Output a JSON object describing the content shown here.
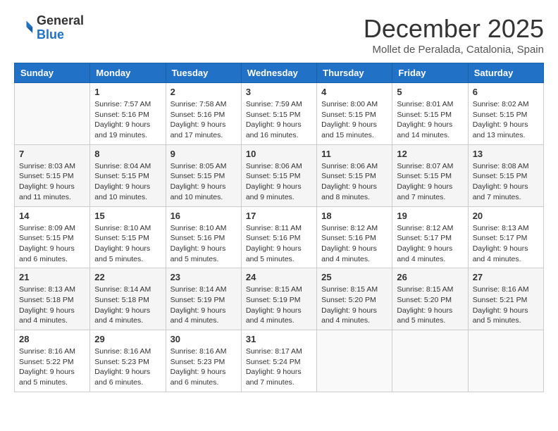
{
  "logo": {
    "general": "General",
    "blue": "Blue"
  },
  "header": {
    "month": "December 2025",
    "location": "Mollet de Peralada, Catalonia, Spain"
  },
  "weekdays": [
    "Sunday",
    "Monday",
    "Tuesday",
    "Wednesday",
    "Thursday",
    "Friday",
    "Saturday"
  ],
  "weeks": [
    [
      {
        "day": "",
        "info": ""
      },
      {
        "day": "1",
        "info": "Sunrise: 7:57 AM\nSunset: 5:16 PM\nDaylight: 9 hours\nand 19 minutes."
      },
      {
        "day": "2",
        "info": "Sunrise: 7:58 AM\nSunset: 5:16 PM\nDaylight: 9 hours\nand 17 minutes."
      },
      {
        "day": "3",
        "info": "Sunrise: 7:59 AM\nSunset: 5:15 PM\nDaylight: 9 hours\nand 16 minutes."
      },
      {
        "day": "4",
        "info": "Sunrise: 8:00 AM\nSunset: 5:15 PM\nDaylight: 9 hours\nand 15 minutes."
      },
      {
        "day": "5",
        "info": "Sunrise: 8:01 AM\nSunset: 5:15 PM\nDaylight: 9 hours\nand 14 minutes."
      },
      {
        "day": "6",
        "info": "Sunrise: 8:02 AM\nSunset: 5:15 PM\nDaylight: 9 hours\nand 13 minutes."
      }
    ],
    [
      {
        "day": "7",
        "info": "Sunrise: 8:03 AM\nSunset: 5:15 PM\nDaylight: 9 hours\nand 11 minutes."
      },
      {
        "day": "8",
        "info": "Sunrise: 8:04 AM\nSunset: 5:15 PM\nDaylight: 9 hours\nand 10 minutes."
      },
      {
        "day": "9",
        "info": "Sunrise: 8:05 AM\nSunset: 5:15 PM\nDaylight: 9 hours\nand 10 minutes."
      },
      {
        "day": "10",
        "info": "Sunrise: 8:06 AM\nSunset: 5:15 PM\nDaylight: 9 hours\nand 9 minutes."
      },
      {
        "day": "11",
        "info": "Sunrise: 8:06 AM\nSunset: 5:15 PM\nDaylight: 9 hours\nand 8 minutes."
      },
      {
        "day": "12",
        "info": "Sunrise: 8:07 AM\nSunset: 5:15 PM\nDaylight: 9 hours\nand 7 minutes."
      },
      {
        "day": "13",
        "info": "Sunrise: 8:08 AM\nSunset: 5:15 PM\nDaylight: 9 hours\nand 7 minutes."
      }
    ],
    [
      {
        "day": "14",
        "info": "Sunrise: 8:09 AM\nSunset: 5:15 PM\nDaylight: 9 hours\nand 6 minutes."
      },
      {
        "day": "15",
        "info": "Sunrise: 8:10 AM\nSunset: 5:15 PM\nDaylight: 9 hours\nand 5 minutes."
      },
      {
        "day": "16",
        "info": "Sunrise: 8:10 AM\nSunset: 5:16 PM\nDaylight: 9 hours\nand 5 minutes."
      },
      {
        "day": "17",
        "info": "Sunrise: 8:11 AM\nSunset: 5:16 PM\nDaylight: 9 hours\nand 5 minutes."
      },
      {
        "day": "18",
        "info": "Sunrise: 8:12 AM\nSunset: 5:16 PM\nDaylight: 9 hours\nand 4 minutes."
      },
      {
        "day": "19",
        "info": "Sunrise: 8:12 AM\nSunset: 5:17 PM\nDaylight: 9 hours\nand 4 minutes."
      },
      {
        "day": "20",
        "info": "Sunrise: 8:13 AM\nSunset: 5:17 PM\nDaylight: 9 hours\nand 4 minutes."
      }
    ],
    [
      {
        "day": "21",
        "info": "Sunrise: 8:13 AM\nSunset: 5:18 PM\nDaylight: 9 hours\nand 4 minutes."
      },
      {
        "day": "22",
        "info": "Sunrise: 8:14 AM\nSunset: 5:18 PM\nDaylight: 9 hours\nand 4 minutes."
      },
      {
        "day": "23",
        "info": "Sunrise: 8:14 AM\nSunset: 5:19 PM\nDaylight: 9 hours\nand 4 minutes."
      },
      {
        "day": "24",
        "info": "Sunrise: 8:15 AM\nSunset: 5:19 PM\nDaylight: 9 hours\nand 4 minutes."
      },
      {
        "day": "25",
        "info": "Sunrise: 8:15 AM\nSunset: 5:20 PM\nDaylight: 9 hours\nand 4 minutes."
      },
      {
        "day": "26",
        "info": "Sunrise: 8:15 AM\nSunset: 5:20 PM\nDaylight: 9 hours\nand 5 minutes."
      },
      {
        "day": "27",
        "info": "Sunrise: 8:16 AM\nSunset: 5:21 PM\nDaylight: 9 hours\nand 5 minutes."
      }
    ],
    [
      {
        "day": "28",
        "info": "Sunrise: 8:16 AM\nSunset: 5:22 PM\nDaylight: 9 hours\nand 5 minutes."
      },
      {
        "day": "29",
        "info": "Sunrise: 8:16 AM\nSunset: 5:23 PM\nDaylight: 9 hours\nand 6 minutes."
      },
      {
        "day": "30",
        "info": "Sunrise: 8:16 AM\nSunset: 5:23 PM\nDaylight: 9 hours\nand 6 minutes."
      },
      {
        "day": "31",
        "info": "Sunrise: 8:17 AM\nSunset: 5:24 PM\nDaylight: 9 hours\nand 7 minutes."
      },
      {
        "day": "",
        "info": ""
      },
      {
        "day": "",
        "info": ""
      },
      {
        "day": "",
        "info": ""
      }
    ]
  ]
}
